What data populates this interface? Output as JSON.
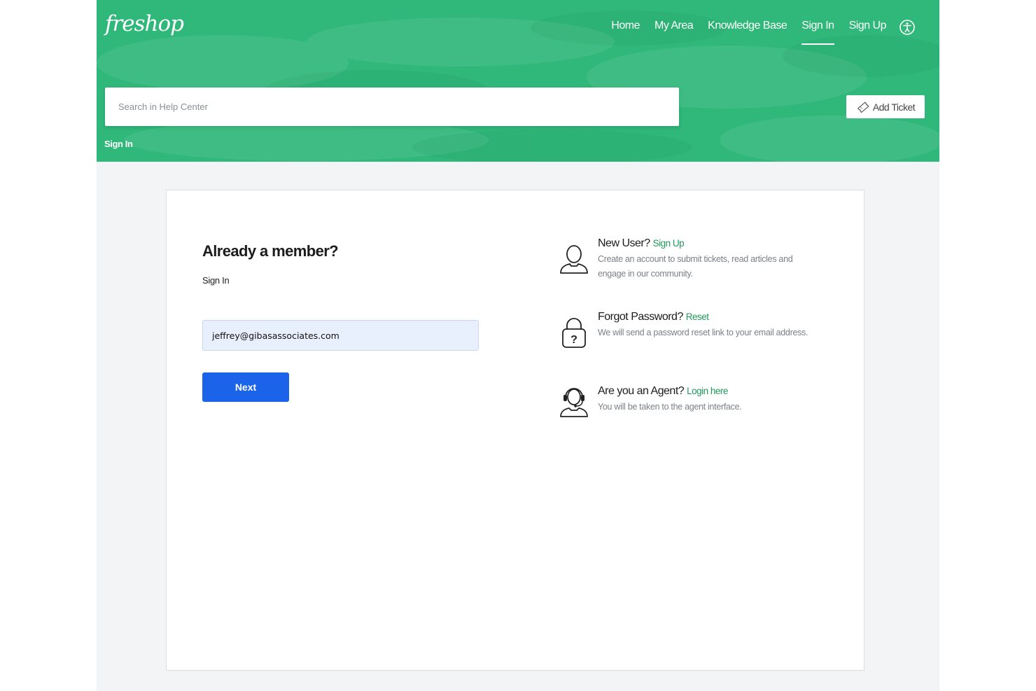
{
  "header": {
    "logo": "freshop",
    "nav": [
      {
        "label": "Home",
        "active": false
      },
      {
        "label": "My Area",
        "active": false
      },
      {
        "label": "Knowledge Base",
        "active": false
      },
      {
        "label": "Sign In",
        "active": true
      },
      {
        "label": "Sign Up",
        "active": false
      }
    ],
    "accessibility_icon": "accessibility-icon",
    "search_placeholder": "Search in Help Center",
    "add_ticket_label": "Add Ticket",
    "breadcrumb": "Sign In",
    "brand_color": "#30b77a"
  },
  "signin": {
    "heading": "Already a member?",
    "subheading": "Sign In",
    "email_value": "jeffrey@gibasassociates.com",
    "next_label": "Next",
    "button_color": "#1b63e8"
  },
  "info": {
    "new_user": {
      "title": "New User?",
      "link": "Sign Up",
      "desc": "Create an account to submit tickets, read articles and engage in our community.",
      "icon": "user-icon"
    },
    "forgot": {
      "title": "Forgot Password?",
      "link": "Reset",
      "desc": "We will send a password reset link to your email address.",
      "icon": "lock-question-icon"
    },
    "agent": {
      "title": "Are you an Agent?",
      "link": "Login here",
      "desc": "You will be taken to the agent interface.",
      "icon": "headset-agent-icon"
    },
    "link_color": "#1f9a5a"
  }
}
